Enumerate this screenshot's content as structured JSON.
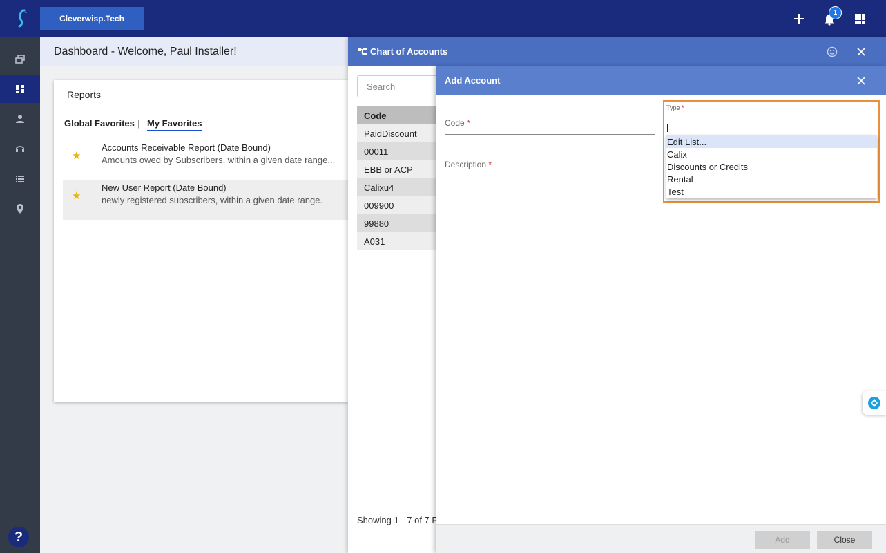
{
  "topbar": {
    "brand": "Cleverwisp.Tech",
    "notification_count": "1",
    "add_icon": "plus-icon",
    "bell_icon": "bell-icon",
    "apps_icon": "grid-icon"
  },
  "rail": {
    "items": [
      "windows-icon",
      "dashboard-icon",
      "person-icon",
      "headset-icon",
      "list-icon",
      "location-pin-icon"
    ],
    "active_index": 1,
    "help": "?"
  },
  "dashboard": {
    "title": "Dashboard - Welcome, Paul Installer!",
    "reports": {
      "title": "Reports",
      "tabs": [
        "Global Favorites",
        "My Favorites"
      ],
      "separator": "|",
      "items": [
        {
          "name": "Accounts Receivable Report (Date Bound)",
          "desc": "Amounts owed by Subscribers, within a given date range..."
        },
        {
          "name": "New User Report (Date Bound)",
          "desc": "newly registered subscribers, within a given date range."
        }
      ]
    }
  },
  "chart_of_accounts": {
    "title": "Chart of Accounts",
    "search_placeholder": "Search",
    "column_header": "Code",
    "rows": [
      "PaidDiscount",
      "00011",
      "EBB or ACP",
      "Calixu4",
      "009900",
      "99880",
      "A031"
    ],
    "footer": "Showing 1 - 7 of 7 R"
  },
  "add_account": {
    "title": "Add Account",
    "code_label": "Code",
    "description_label": "Description",
    "required_mark": "*",
    "type_label": "Type",
    "type_options": [
      "Edit List...",
      "Calix",
      "Discounts or Credits",
      "Rental",
      "Test"
    ],
    "highlighted_option": 0,
    "add_button": "Add",
    "close_button": "Close"
  },
  "colors": {
    "topbar": "#1a2a7c",
    "rail": "#333a48",
    "panel_header": "#4a6fc1",
    "focus_border": "#e8903a"
  }
}
